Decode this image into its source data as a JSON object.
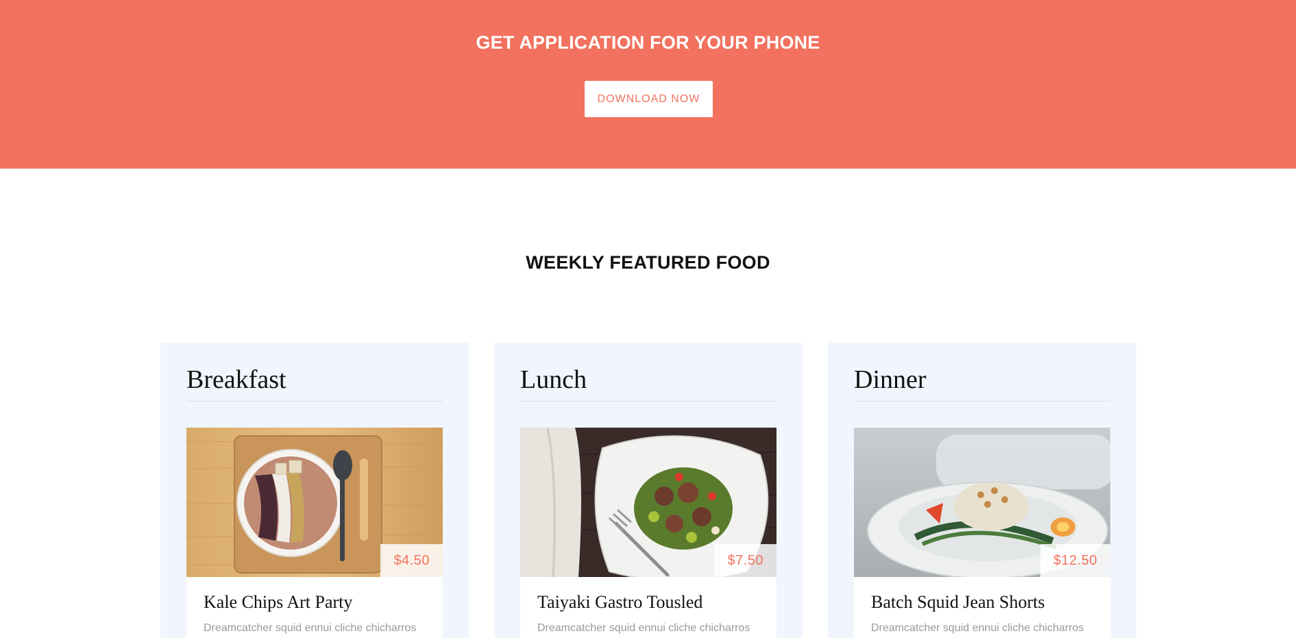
{
  "banner": {
    "title": "GET APPLICATION FOR YOUR PHONE",
    "button_label": "DOWNLOAD NOW",
    "background": "#f2725f"
  },
  "featured": {
    "title": "WEEKLY FEATURED FOOD",
    "cards": [
      {
        "heading": "Breakfast",
        "item_name": "Kale Chips Art Party",
        "price": "$4.50",
        "description": "Dreamcatcher squid ennui cliche chicharros"
      },
      {
        "heading": "Lunch",
        "item_name": "Taiyaki Gastro Tousled",
        "price": "$7.50",
        "description": "Dreamcatcher squid ennui cliche chicharros"
      },
      {
        "heading": "Dinner",
        "item_name": "Batch Squid Jean Shorts",
        "price": "$12.50",
        "description": "Dreamcatcher squid ennui cliche chicharros"
      }
    ]
  },
  "colors": {
    "accent": "#f2725f",
    "card_background": "#f1f5fd"
  }
}
